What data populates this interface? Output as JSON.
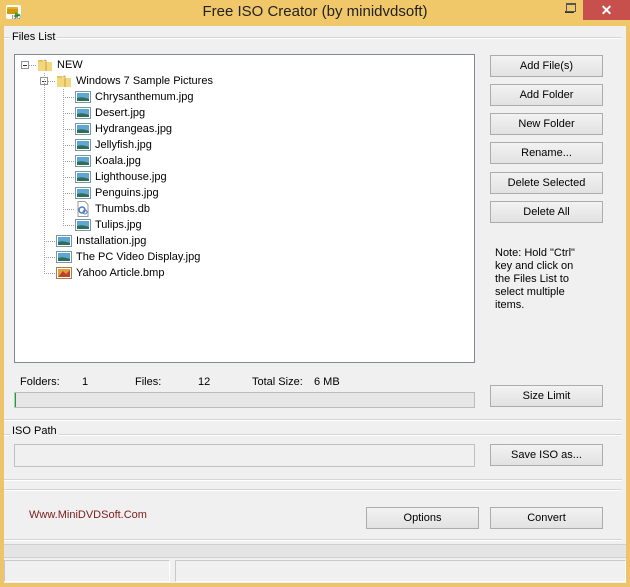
{
  "window": {
    "title": "Free ISO Creator (by minidvdsoft)",
    "close_glyph": "✕"
  },
  "files_list": {
    "label": "Files List",
    "tree": [
      {
        "label": "NEW",
        "type": "folder",
        "level": 0,
        "expanded": true
      },
      {
        "label": "Windows 7 Sample Pictures",
        "type": "folder",
        "level": 1,
        "expanded": true
      },
      {
        "label": "Chrysanthemum.jpg",
        "type": "image",
        "level": 2
      },
      {
        "label": "Desert.jpg",
        "type": "image",
        "level": 2
      },
      {
        "label": "Hydrangeas.jpg",
        "type": "image",
        "level": 2
      },
      {
        "label": "Jellyfish.jpg",
        "type": "image",
        "level": 2
      },
      {
        "label": "Koala.jpg",
        "type": "image",
        "level": 2
      },
      {
        "label": "Lighthouse.jpg",
        "type": "image",
        "level": 2
      },
      {
        "label": "Penguins.jpg",
        "type": "image",
        "level": 2
      },
      {
        "label": "Thumbs.db",
        "type": "system-file",
        "level": 2
      },
      {
        "label": "Tulips.jpg",
        "type": "image",
        "level": 2
      },
      {
        "label": "Installation.jpg",
        "type": "image",
        "level": 1
      },
      {
        "label": "The PC Video Display.jpg",
        "type": "image",
        "level": 1
      },
      {
        "label": "Yahoo Article.bmp",
        "type": "bitmap",
        "level": 1
      }
    ]
  },
  "buttons": {
    "add_files": "Add File(s)",
    "add_folder": "Add Folder",
    "new_folder": "New Folder",
    "rename": "Rename...",
    "delete_selected": "Delete Selected",
    "delete_all": "Delete All",
    "size_limit": "Size Limit",
    "save_iso_as": "Save ISO as...",
    "options": "Options",
    "convert": "Convert"
  },
  "note": "Note: Hold \"Ctrl\" key and click on the Files List to select multiple items.",
  "stats": {
    "folders_label": "Folders:",
    "folders_value": "1",
    "files_label": "Files:",
    "files_value": "12",
    "total_size_label": "Total Size:",
    "total_size_value": "6 MB"
  },
  "progress": {
    "percent": 0,
    "color": "#06b025"
  },
  "iso_path": {
    "label": "ISO Path",
    "value": ""
  },
  "website": "Www.MiniDVDSoft.Com",
  "status_bar": {
    "left": "",
    "right": ""
  }
}
